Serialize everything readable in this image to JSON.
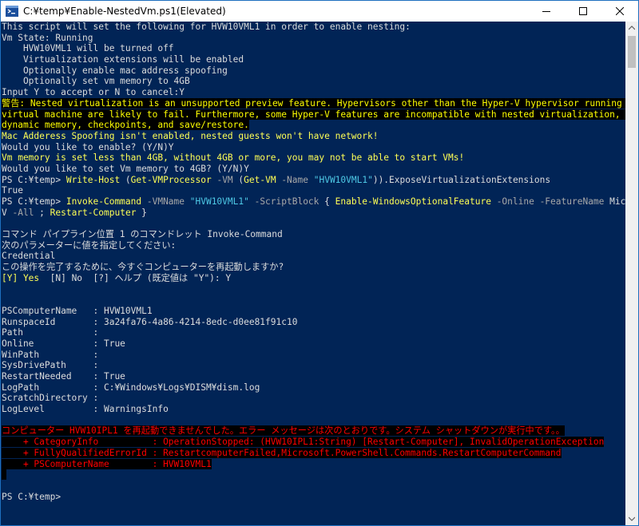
{
  "window": {
    "title": "C:¥temp¥Enable-NestedVm.ps1(Elevated)"
  },
  "colors": {
    "console_bg": "#012456",
    "warning_fg": "#ffff00",
    "error_fg": "#ff0000"
  },
  "console": {
    "l01": "This script will set the following for HVW10VML1 in order to enable nesting:",
    "l02": "Vm State: Running",
    "l03": "    HVW10VML1 will be turned off",
    "l04": "    Virtualization extensions will be enabled",
    "l05": "    Optionally enable mac address spoofing",
    "l06": "    Optionally set vm memory to 4GB",
    "l07": "Input Y to accept or N to cancel:Y",
    "l08": "警告: Nested virtualization is an unsupported preview feature. Hypervisors other than the Hyper-V hypervisor running in a guest",
    "l09": "virtual machine are likely to fail. Furthermore, some Hyper-V features are incompatible with nested virtualization, such as",
    "l10": "dynamic memory, checkpoints, and save/restore.",
    "l11": "Mac Adderess Spoofing isn't enabled, nested guests won't have network!",
    "l12": "Would you like to enable? (Y/N)Y",
    "l13": "Vm memory is set less than 4GB, without 4GB or more, you may not be able to start VMs!",
    "l14": "Would you like to set Vm memory to 4GB? (Y/N)Y",
    "l15_prompt": "PS C:¥temp> ",
    "l15_cmd": "Write-Host",
    "l15_p1": " (",
    "l15_c2": "Get-VMProcessor",
    "l15_a1": " -VM ",
    "l15_p2": "(",
    "l15_c3": "Get-VM",
    "l15_a2": " -Name ",
    "l15_s1": "\"HVW10VML1\"",
    "l15_rest": ")).ExposeVirtualizationExtensions",
    "l16": "True",
    "l17_prompt": "PS C:¥temp> ",
    "l17_cmd": "Invoke-Command",
    "l17_a1": " -VMName ",
    "l17_s1": "\"HVW10VML1\"",
    "l17_a2": " -ScriptBlock ",
    "l17_b1": "{ ",
    "l17_c2": "Enable-WindowsOptionalFeature",
    "l17_a3": " -Online -FeatureName ",
    "l17_rest": "Microsoft-Hyper-",
    "l18_v": "V",
    "l18_a": " -All ",
    "l18_semi": "; ",
    "l18_c": "Restart-Computer",
    "l18_end": " }",
    "l19": "",
    "l20": "コマンド パイプライン位置 1 のコマンドレット Invoke-Command",
    "l21": "次のパラメーターに値を指定してください:",
    "l22": "Credential",
    "l23": "この操作を完了するために、今すぐコンピューターを再起動しますか?",
    "l24_y": "[Y] Yes",
    "l24_rest": "  [N] No  [?] ヘルプ (既定値は \"Y\"): Y",
    "l25": "",
    "l26": "",
    "l27": "PSComputerName   : HVW10VML1",
    "l28": "RunspaceId       : 3a24fa76-4a86-4214-8edc-d0ee81f91c10",
    "l29": "Path             :",
    "l30": "Online           : True",
    "l31": "WinPath          :",
    "l32": "SysDrivePath     :",
    "l33": "RestartNeeded    : True",
    "l34": "LogPath          : C:¥Windows¥Logs¥DISM¥dism.log",
    "l35": "ScratchDirectory :",
    "l36": "LogLevel         : WarningsInfo",
    "l37": "",
    "l38": "コンピューター HVW10IPL1 を再起動できませんでした。エラー メッセージは次のとおりです。システム シャットダウンが実行中です。。",
    "l39": "    + CategoryInfo          : OperationStopped: (HVW10IPL1:String) [Restart-Computer], InvalidOperationException",
    "l40": "    + FullyQualifiedErrorId : RestartcomputerFailed,Microsoft.PowerShell.Commands.RestartComputerCommand",
    "l41": "    + PSComputerName        : HVW10VML1",
    "l42": "",
    "l43": "",
    "l44": "PS C:¥temp>"
  }
}
